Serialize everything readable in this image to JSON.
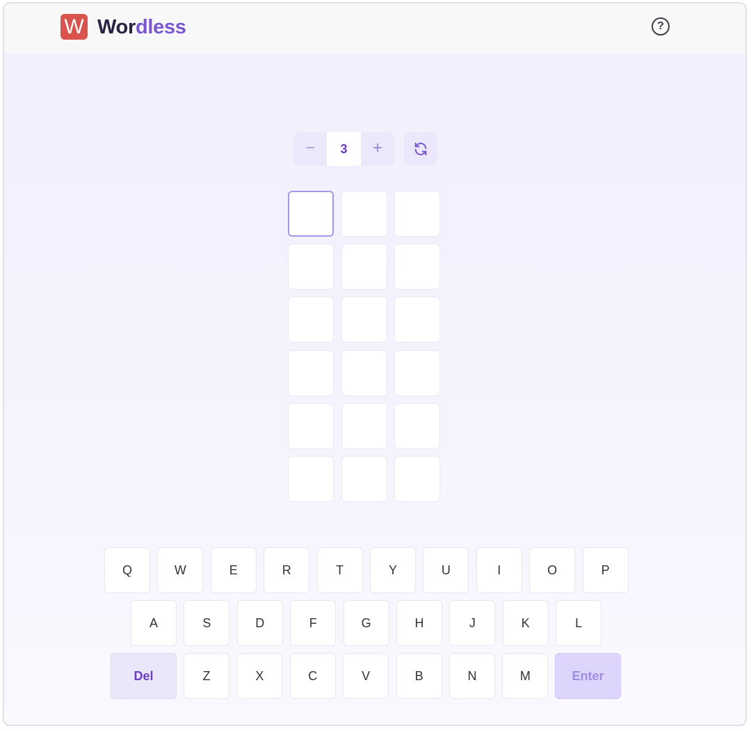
{
  "header": {
    "logo_letter": "W",
    "brand_part1": "Wor",
    "brand_part2": "dless",
    "help_glyph": "?",
    "help_icon": "question-circle-icon"
  },
  "controls": {
    "minus_label": "−",
    "word_length": "3",
    "plus_label": "+",
    "reset_icon": "refresh-icon"
  },
  "board": {
    "columns": 3,
    "rows": 6,
    "active_row": 0,
    "active_col": 0,
    "tiles": [
      [
        "",
        "",
        ""
      ],
      [
        "",
        "",
        ""
      ],
      [
        "",
        "",
        ""
      ],
      [
        "",
        "",
        ""
      ],
      [
        "",
        "",
        ""
      ],
      [
        "",
        "",
        ""
      ]
    ]
  },
  "keyboard": {
    "row1": [
      "Q",
      "W",
      "E",
      "R",
      "T",
      "Y",
      "U",
      "I",
      "O",
      "P"
    ],
    "row2": [
      "A",
      "S",
      "D",
      "F",
      "G",
      "H",
      "J",
      "K",
      "L"
    ],
    "row3": [
      "Z",
      "X",
      "C",
      "V",
      "B",
      "N",
      "M"
    ],
    "del_label": "Del",
    "enter_label": "Enter"
  },
  "colors": {
    "accent": "#7a57d1",
    "logo_bg": "#d9534f",
    "active_tile_border": "#a896e8"
  }
}
